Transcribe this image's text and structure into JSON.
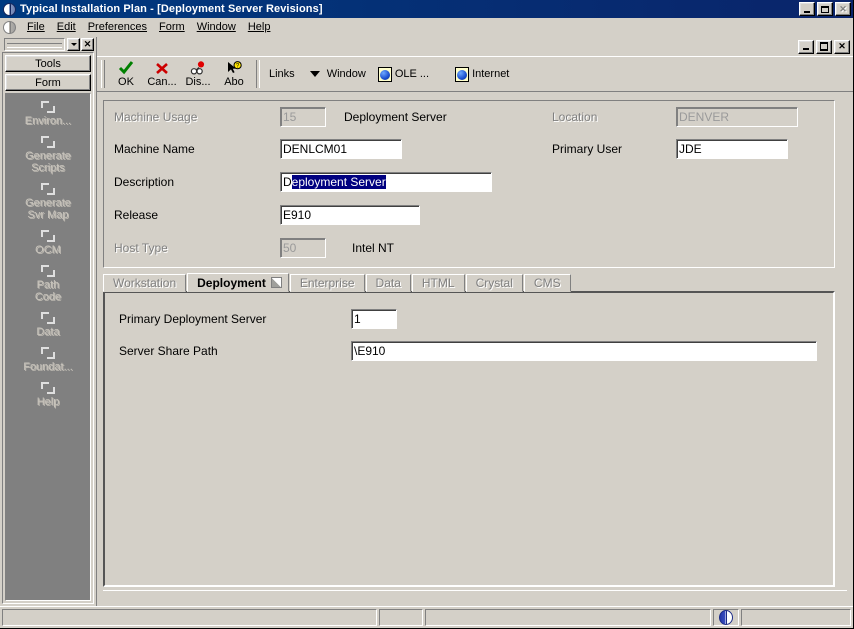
{
  "window": {
    "title": "Typical Installation Plan - [Deployment Server Revisions]",
    "app_icon": "globe-icon",
    "minimize_label": "_",
    "maximize_label": "□",
    "close_label": "✕",
    "restore_label": "❐"
  },
  "menu": {
    "items": [
      {
        "label": "File",
        "accel": "F"
      },
      {
        "label": "Edit",
        "accel": "E"
      },
      {
        "label": "Preferences",
        "accel": "P"
      },
      {
        "label": "Form",
        "accel": "m"
      },
      {
        "label": "Window",
        "accel": "W"
      },
      {
        "label": "Help",
        "accel": "H"
      }
    ]
  },
  "toolbar": {
    "buttons": [
      {
        "label": "OK",
        "icon": "check-icon"
      },
      {
        "label": "Can...",
        "icon": "cross-icon"
      },
      {
        "label": "Dis...",
        "icon": "glasses-icon"
      },
      {
        "label": "Abo",
        "icon": "cursor-question-icon"
      }
    ],
    "links_label": "Links",
    "window_label": "Window",
    "ole_label": "OLE ...",
    "internet_label": "Internet"
  },
  "sidebar": {
    "combo_value": "",
    "close_label": "✕",
    "tools_label": "Tools",
    "form_label": "Form",
    "items": [
      {
        "label": "Environ...",
        "icon": "exit-arrow-icon"
      },
      {
        "label": "Generate\nScripts",
        "icon": "exit-arrow-icon"
      },
      {
        "label": "Generate\nSvr Map",
        "icon": "exit-arrow-icon"
      },
      {
        "label": "OCM",
        "icon": "exit-arrow-icon"
      },
      {
        "label": "Path\nCode",
        "icon": "exit-arrow-icon"
      },
      {
        "label": "Data",
        "icon": "exit-arrow-icon"
      },
      {
        "label": "Foundat...",
        "icon": "exit-arrow-icon"
      },
      {
        "label": "Help",
        "icon": "exit-arrow-icon"
      }
    ]
  },
  "form": {
    "machine_usage_label": "Machine Usage",
    "machine_usage_value": "15",
    "machine_usage_text": "Deployment Server",
    "location_label": "Location",
    "location_value": "DENVER",
    "machine_name_label": "Machine Name",
    "machine_name_value": "DENLCM01",
    "primary_user_label": "Primary User",
    "primary_user_value": "JDE",
    "description_label": "Description",
    "description_value_prefix": "D",
    "description_value_selected": "eployment Server",
    "release_label": "Release",
    "release_value": "E910",
    "host_type_label": "Host Type",
    "host_type_value": "50",
    "host_type_text": "Intel NT"
  },
  "tabs": [
    {
      "label": "Workstation",
      "active": false
    },
    {
      "label": "Deployment",
      "active": true
    },
    {
      "label": "Enterprise",
      "active": false
    },
    {
      "label": "Data",
      "active": false
    },
    {
      "label": "HTML",
      "active": false
    },
    {
      "label": "Crystal",
      "active": false
    },
    {
      "label": "CMS",
      "active": false
    }
  ],
  "tab_content": {
    "primary_deployment_server_label": "Primary Deployment Server",
    "primary_deployment_server_value": "1",
    "server_share_path_label": "Server Share Path",
    "server_share_path_value": "\\E910"
  },
  "statusbar": {
    "panel1": "",
    "panel2": "",
    "panel3": "",
    "globe_icon": "globe-icon"
  },
  "colors": {
    "face": "#d4d0c8",
    "title_active": "#0a246a",
    "selection": "#000080",
    "disabled_text": "#808080",
    "sidebar_panel": "#808080"
  }
}
